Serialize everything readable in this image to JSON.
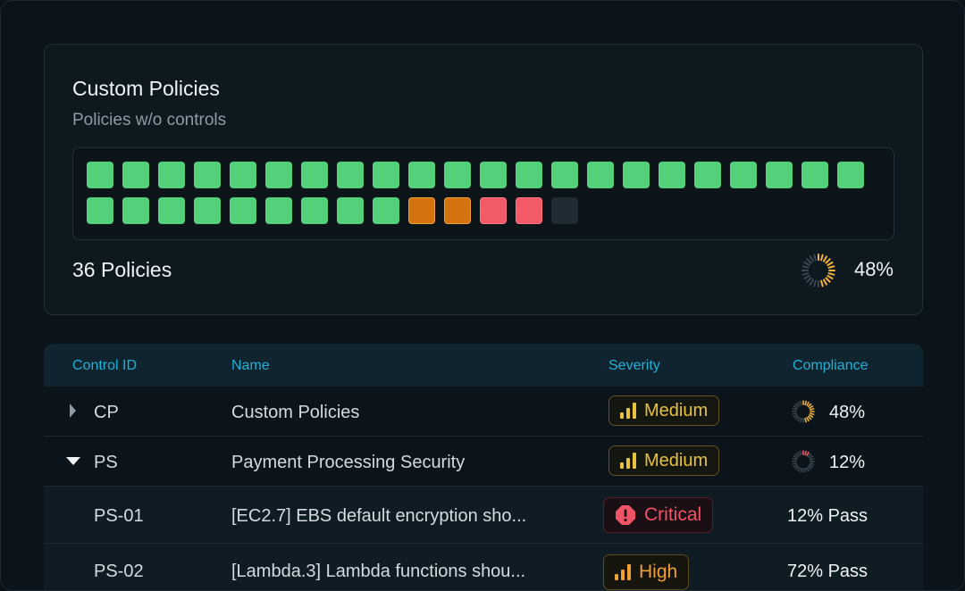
{
  "card": {
    "title": "Custom Policies",
    "subtitle": "Policies w/o controls",
    "count_label": "36 Policies",
    "compliance_pct": "48%",
    "compliance_value": 0.48,
    "grid": {
      "row1": [
        "pass",
        "pass",
        "pass",
        "pass",
        "pass",
        "pass",
        "pass",
        "pass",
        "pass",
        "pass",
        "pass",
        "pass",
        "pass",
        "pass",
        "pass",
        "pass",
        "pass",
        "pass",
        "pass",
        "pass",
        "pass",
        "pass"
      ],
      "row2": [
        "pass",
        "pass",
        "pass",
        "pass",
        "pass",
        "pass",
        "pass",
        "pass",
        "pass",
        "warn",
        "warn",
        "fail",
        "fail",
        "none"
      ]
    }
  },
  "colors": {
    "pass": "#55d07a",
    "warn": "#d4720f",
    "fail": "#f25a68",
    "none": "#1f2b33",
    "ring_active": "#f2b33a",
    "ring_critical": "#f25a68",
    "ring_inactive": "#3a4650"
  },
  "table": {
    "headers": {
      "control_id": "Control ID",
      "name": "Name",
      "severity": "Severity",
      "compliance": "Compliance"
    },
    "rows": [
      {
        "id": "CP",
        "name": "Custom Policies",
        "severity": "Medium",
        "compliance": "48%",
        "compliance_value": 0.48,
        "expanded": false
      },
      {
        "id": "PS",
        "name": "Payment Processing Security",
        "severity": "Medium",
        "compliance": "12%",
        "compliance_value": 0.12,
        "expanded": true
      },
      {
        "id": "PS-01",
        "name": "[EC2.7] EBS default encryption sho...",
        "severity": "Critical",
        "compliance": "12% Pass"
      },
      {
        "id": "PS-02",
        "name": "[Lambda.3] Lambda functions shou...",
        "severity": "High",
        "compliance": "72% Pass"
      }
    ]
  },
  "icons": {
    "collapsed": "caret-right-icon",
    "expanded": "caret-down-icon",
    "severity_bars": "signal-bars-icon",
    "critical": "alert-octagon-icon"
  }
}
